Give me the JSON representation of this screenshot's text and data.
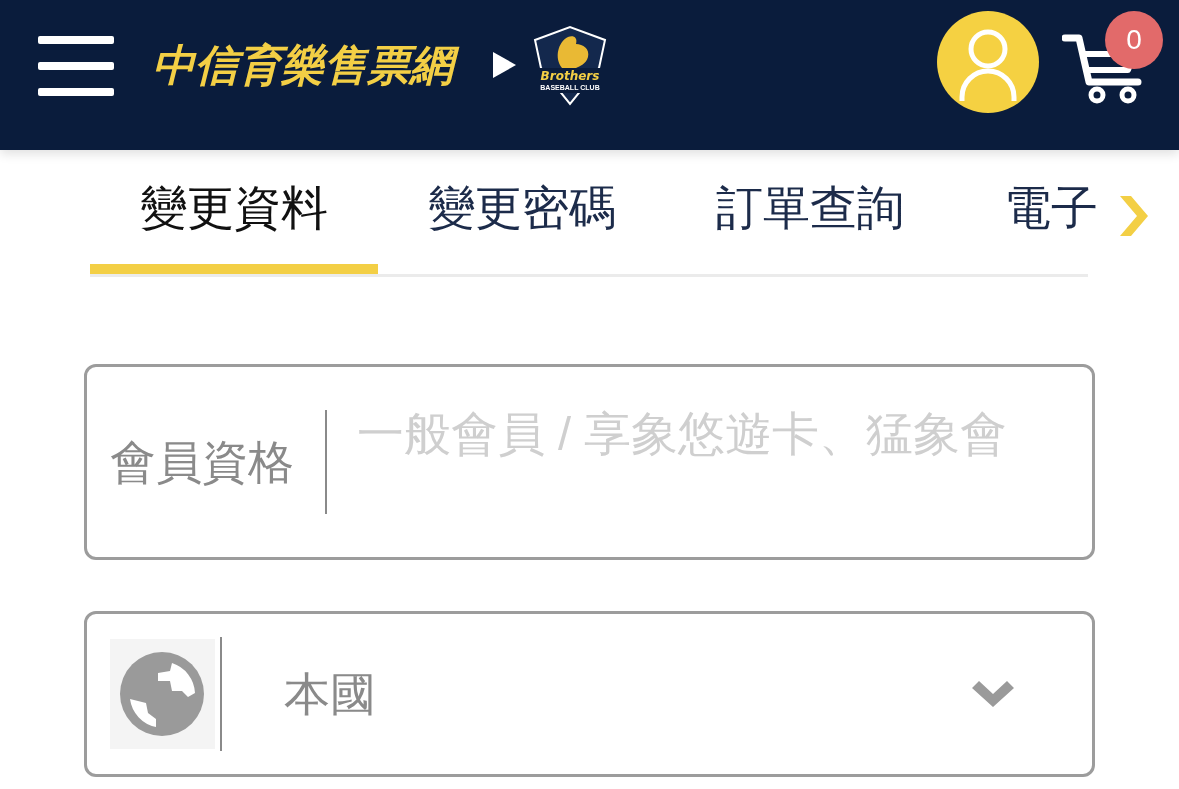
{
  "header": {
    "site_title": "中信育樂售票網",
    "team_logo": {
      "text": "Brothers",
      "subtext": "BASEBALL CLUB"
    },
    "cart": {
      "count": "0"
    }
  },
  "tabs": [
    {
      "label": "變更資料",
      "selected": true
    },
    {
      "label": "變更密碼",
      "selected": false
    },
    {
      "label": "訂單查詢",
      "selected": false
    },
    {
      "label": "電子",
      "selected": false
    }
  ],
  "form": {
    "fields": [
      {
        "kind": "text",
        "label": "會員資格",
        "placeholder": "一般會員 / 享象悠遊卡、猛象會"
      },
      {
        "kind": "select",
        "value": "本國"
      }
    ]
  }
}
